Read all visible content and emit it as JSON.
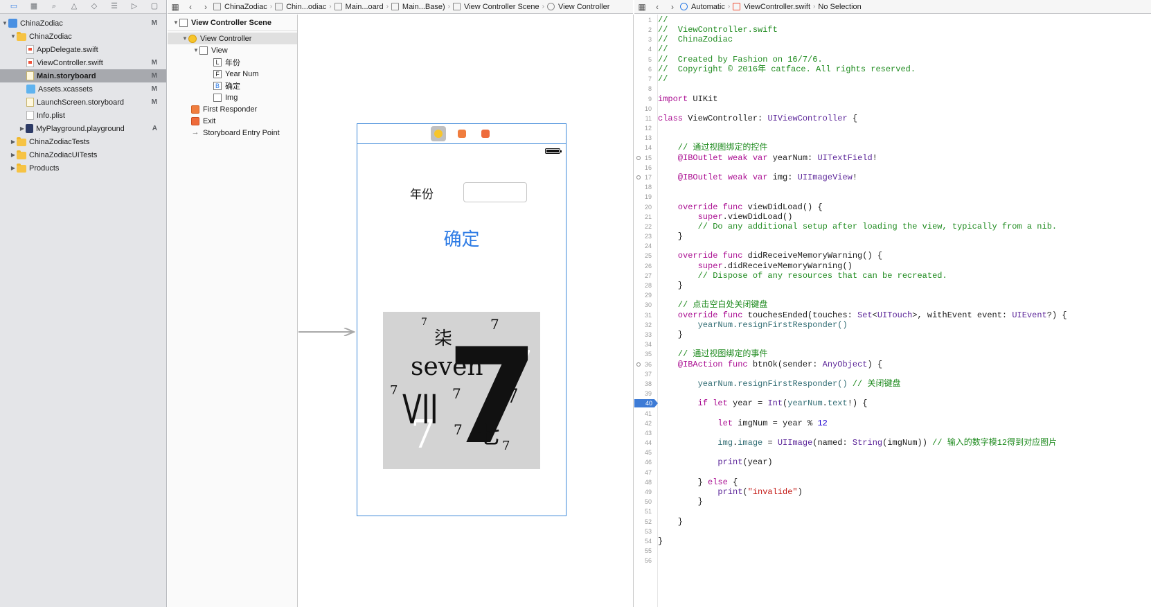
{
  "navigator": {
    "project": {
      "label": "ChinaZodiac",
      "badge": "M"
    },
    "group": {
      "label": "ChinaZodiac"
    },
    "files": [
      {
        "label": "AppDelegate.swift",
        "badge": ""
      },
      {
        "label": "ViewController.swift",
        "badge": "M"
      },
      {
        "label": "Main.storyboard",
        "badge": "M"
      },
      {
        "label": "Assets.xcassets",
        "badge": "M"
      },
      {
        "label": "LaunchScreen.storyboard",
        "badge": "M"
      },
      {
        "label": "Info.plist",
        "badge": ""
      },
      {
        "label": "MyPlayground.playground",
        "badge": "A"
      }
    ],
    "groups": [
      {
        "label": "ChinaZodiacTests"
      },
      {
        "label": "ChinaZodiacUITests"
      },
      {
        "label": "Products"
      }
    ]
  },
  "jumpbar": {
    "items": [
      "ChinaZodiac",
      "Chin...odiac",
      "Main...oard",
      "Main...Base)",
      "View Controller Scene",
      "View Controller"
    ]
  },
  "editor_jumpbar": {
    "mode": "Automatic",
    "file": "ViewController.swift",
    "selection": "No Selection"
  },
  "outline": {
    "header": "View Controller Scene",
    "items": [
      {
        "label": "View Controller",
        "icon": ""
      },
      {
        "label": "View",
        "icon": ""
      },
      {
        "label": "年份",
        "icon": "L"
      },
      {
        "label": "Year Num",
        "icon": "F"
      },
      {
        "label": "确定",
        "icon": "B"
      },
      {
        "label": "Img",
        "icon": ""
      },
      {
        "label": "First Responder",
        "icon": ""
      },
      {
        "label": "Exit",
        "icon": ""
      },
      {
        "label": "Storyboard Entry Point",
        "icon": "→"
      }
    ]
  },
  "canvas": {
    "year_label": "年份",
    "year_field_value": "",
    "confirm_button": "确定",
    "zodiac_image": {
      "word": "seven",
      "roman": "VII",
      "cn_small": "柒",
      "cn_big": "七",
      "digit": "7"
    }
  },
  "editor": {
    "line_numbers": [
      "1",
      "2",
      "3",
      "4",
      "5",
      "6",
      "7",
      "8",
      "9",
      "10",
      "11",
      "12",
      "13",
      "14",
      "15",
      "16",
      "17",
      "18",
      "19",
      "20",
      "21",
      "22",
      "23",
      "24",
      "25",
      "26",
      "27",
      "28",
      "29",
      "30",
      "31",
      "32",
      "33",
      "34",
      "35",
      "36",
      "37",
      "38",
      "39",
      "40",
      "41",
      "42",
      "43",
      "44",
      "45",
      "46",
      "47",
      "48",
      "49",
      "50",
      "51",
      "52",
      "53",
      "54",
      "55",
      "56"
    ],
    "active_line": "40",
    "code": {
      "l1": "//",
      "l2": "//  ViewController.swift",
      "l3": "//  ChinaZodiac",
      "l4": "//",
      "l5": "//  Created by Fashion on 16/7/6.",
      "l6": "//  Copyright © 2016年 catface. All rights reserved.",
      "l7": "//",
      "l9_kw": "import",
      "l9_rest": " UIKit",
      "l11_kw": "class",
      "l11_name": " ViewController: ",
      "l11_type": "UIViewController",
      "l11_end": " {",
      "l14": "    // 通过视图绑定的控件",
      "l15_attr": "    @IBOutlet",
      "l15_kw": " weak var",
      "l15_name": " yearNum: ",
      "l15_type": "UITextField",
      "l15_end": "!",
      "l17_attr": "    @IBOutlet",
      "l17_kw": " weak var",
      "l17_name": " img: ",
      "l17_type": "UIImageView",
      "l17_end": "!",
      "l20_kw": "    override func",
      "l20_rest": " viewDidLoad() {",
      "l21_kw": "        super",
      "l21_rest": ".viewDidLoad()",
      "l22": "        // Do any additional setup after loading the view, typically from a nib.",
      "l23": "    }",
      "l25_kw": "    override func",
      "l25_rest": " didReceiveMemoryWarning() {",
      "l26_kw": "        super",
      "l26_rest": ".didReceiveMemoryWarning()",
      "l27": "        // Dispose of any resources that can be recreated.",
      "l28": "    }",
      "l30": "    // 点击空白处关闭键盘",
      "l31_kw": "    override func",
      "l31_a": " touchesEnded(touches: ",
      "l31_t1": "Set",
      "l31_b": "<",
      "l31_t2": "UITouch",
      "l31_c": ">, withEvent event: ",
      "l31_t3": "UIEvent",
      "l31_d": "?) {",
      "l32_id": "        yearNum",
      "l32_rest": ".resignFirstResponder()",
      "l33": "    }",
      "l35": "    // 通过视图绑定的事件",
      "l36_attr": "    @IBAction",
      "l36_kw": " func",
      "l36_a": " btnOk(sender: ",
      "l36_t": "AnyObject",
      "l36_b": ") {",
      "l38_id": "        yearNum",
      "l38_rest": ".resignFirstResponder() ",
      "l38_com": "// 关闭键盘",
      "l40_kw": "        if let",
      "l40_a": " year = ",
      "l40_t": "Int",
      "l40_b": "(",
      "l40_id": "yearNum",
      "l40_c": ".",
      "l40_id2": "text",
      "l40_d": "!) {",
      "l42_kw": "            let",
      "l42_a": " imgNum = year % ",
      "l42_num": "12",
      "l44_id": "            img",
      "l44_a": ".",
      "l44_id2": "image",
      "l44_b": " = ",
      "l44_t": "UIImage",
      "l44_c": "(named: ",
      "l44_t2": "String",
      "l44_d": "(imgNum)) ",
      "l44_com": "// 输入的数字模12得到对应图片",
      "l46_fn": "            print",
      "l46_rest": "(year)",
      "l48_a": "        } ",
      "l48_kw": "else",
      "l48_b": " {",
      "l49_fn": "            print",
      "l49_a": "(",
      "l49_str": "\"invalide\"",
      "l49_b": ")",
      "l50": "        }",
      "l52": "    }",
      "l54": "}"
    }
  },
  "colors": {
    "accent": "#2d7be5",
    "comment": "#1f8b1f",
    "keyword": "#aa0d91",
    "type": "#5c2699",
    "selection": "#a7a9ae"
  }
}
